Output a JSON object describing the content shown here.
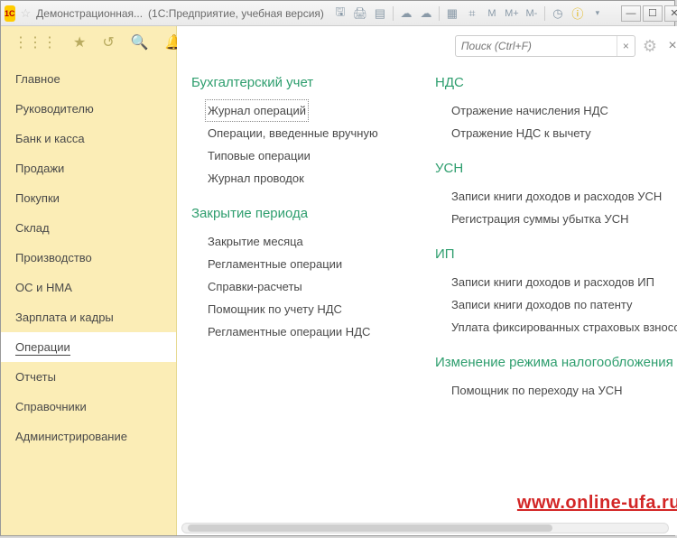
{
  "window": {
    "app_badge": "1C",
    "title_prefix": "Демонстрационная...",
    "title_suffix": "(1С:Предприятие, учебная версия)"
  },
  "toolbar_icons": [
    "save",
    "print",
    "output",
    "sep",
    "cloud",
    "cloud2",
    "sep",
    "calendar",
    "calc",
    "M",
    "M+",
    "M-",
    "sep",
    "clock",
    "info",
    "arrow"
  ],
  "sidebar_icons": {
    "grid": "⋮⋮⋮",
    "star": "★",
    "history": "↺",
    "search": "🔍",
    "bell": "🔔"
  },
  "sidebar": {
    "items": [
      {
        "label": "Главное"
      },
      {
        "label": "Руководителю"
      },
      {
        "label": "Банк и касса"
      },
      {
        "label": "Продажи"
      },
      {
        "label": "Покупки"
      },
      {
        "label": "Склад"
      },
      {
        "label": "Производство"
      },
      {
        "label": "ОС и НМА"
      },
      {
        "label": "Зарплата и кадры"
      },
      {
        "label": "Операции",
        "active": true
      },
      {
        "label": "Отчеты"
      },
      {
        "label": "Справочники"
      },
      {
        "label": "Администрирование"
      }
    ]
  },
  "search": {
    "placeholder": "Поиск (Ctrl+F)",
    "clear": "×",
    "close": "×"
  },
  "columns": [
    {
      "sections": [
        {
          "title": "Бухгалтерский учет",
          "items": [
            {
              "label": "Журнал операций",
              "selected": true
            },
            {
              "label": "Операции, введенные вручную"
            },
            {
              "label": "Типовые операции"
            },
            {
              "label": "Журнал проводок"
            }
          ]
        },
        {
          "title": "Закрытие периода",
          "items": [
            {
              "label": "Закрытие месяца"
            },
            {
              "label": "Регламентные операции"
            },
            {
              "label": "Справки-расчеты"
            },
            {
              "label": "Помощник по учету НДС"
            },
            {
              "label": "Регламентные операции НДС"
            }
          ]
        }
      ]
    },
    {
      "sections": [
        {
          "title": "НДС",
          "items": [
            {
              "label": "Отражение начисления НДС"
            },
            {
              "label": "Отражение НДС к вычету"
            }
          ]
        },
        {
          "title": "УСН",
          "items": [
            {
              "label": "Записи книги доходов и расходов УСН"
            },
            {
              "label": "Регистрация суммы убытка УСН"
            }
          ]
        },
        {
          "title": "ИП",
          "items": [
            {
              "label": "Записи книги доходов и расходов ИП"
            },
            {
              "label": "Записи книги доходов по патенту"
            },
            {
              "label": "Уплата фиксированных страховых взносов"
            }
          ]
        },
        {
          "title": "Изменение режима налогообложения",
          "items": [
            {
              "label": "Помощник по переходу на УСН"
            }
          ]
        }
      ]
    }
  ],
  "watermark": "www.online-ufa.ru"
}
